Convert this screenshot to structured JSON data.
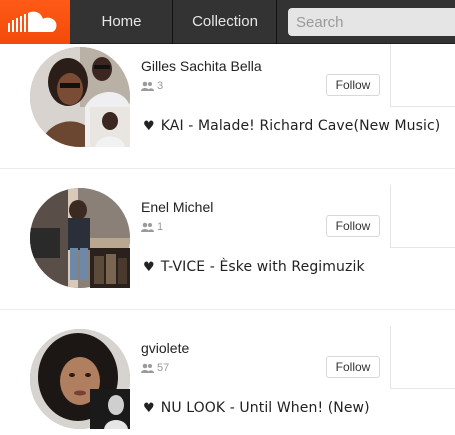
{
  "header": {
    "logo_icon": "soundcloud-cloud-icon",
    "nav": [
      {
        "label": "Home"
      },
      {
        "label": "Collection"
      }
    ],
    "search_placeholder": "Search"
  },
  "users": [
    {
      "name": "Gilles Sachita Bella",
      "followers": "3",
      "follow_label": "Follow",
      "track": "KAI - Malade! Richard Cave(New Music)"
    },
    {
      "name": "Enel Michel",
      "followers": "1",
      "follow_label": "Follow",
      "track": "T-VICE - Èske with Regimuzik"
    },
    {
      "name": "gviolete",
      "followers": "57",
      "follow_label": "Follow",
      "track": "NU LOOK - Until When! (New)"
    }
  ],
  "colors": {
    "brand": "#f34f0f",
    "header_bg": "#333333"
  }
}
